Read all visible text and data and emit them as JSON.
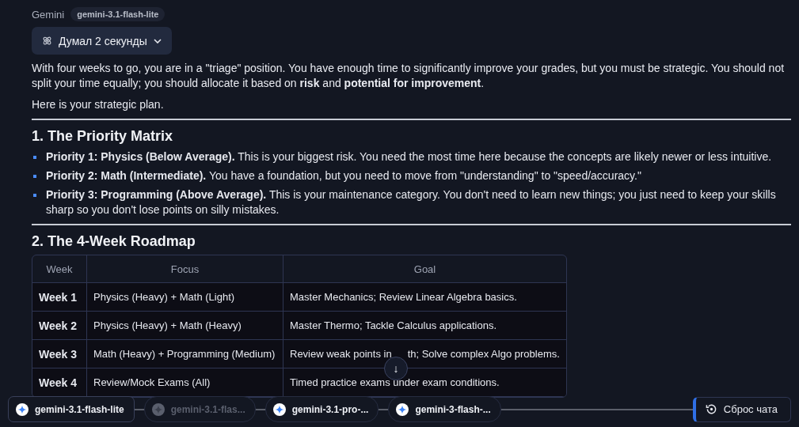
{
  "header": {
    "sender": "Gemini",
    "model_badge": "gemini-3.1-flash-lite"
  },
  "thinking": {
    "label": "Думал 2 секунды"
  },
  "intro": [
    "With four weeks to go, you are in a \"triage\" position. You have enough time to significantly improve your grades, but you must be strategic. You should not split your time equally; you should allocate it based on **risk** and **potential for improvement**.",
    "Here is your strategic plan."
  ],
  "sections": [
    {
      "heading": "1. The Priority Matrix",
      "bullets": [
        "**Priority 1: Physics (Below Average).** This is your biggest risk. You need the most time here because the concepts are likely newer or less intuitive.",
        "**Priority 2: Math (Intermediate).** You have a foundation, but you need to move from \"understanding\" to \"speed/accuracy.\"",
        "**Priority 3: Programming (Above Average).** This is your maintenance category. You don't need to learn new things; you just need to keep your skills sharp so you don't lose points on silly mistakes."
      ]
    },
    {
      "heading": "2. The 4-Week Roadmap",
      "table": {
        "columns": [
          "Week",
          "Focus",
          "Goal"
        ],
        "rows": [
          [
            "Week 1",
            "Physics (Heavy) + Math (Light)",
            "Master Mechanics; Review Linear Algebra basics."
          ],
          [
            "Week 2",
            "Physics (Heavy) + Math (Heavy)",
            "Master Thermo; Tackle Calculus applications."
          ],
          [
            "Week 3",
            "Math (Heavy) + Programming (Medium)",
            [
              "Review weak points in",
              "th; Solve complex Algo problems."
            ]
          ],
          [
            "Week 4",
            "Review/Mock Exams (All)",
            "Timed practice exams under exam conditions."
          ]
        ]
      }
    }
  ],
  "scroll_button": {
    "label": "↓"
  },
  "model_chips": [
    {
      "label": "gemini-3.1-flash-lite",
      "selected": true,
      "disabled": false
    },
    {
      "label": "gemini-3.1-flas...",
      "selected": false,
      "disabled": true
    },
    {
      "label": "gemini-3.1-pro-...",
      "selected": false,
      "disabled": false
    },
    {
      "label": "gemini-3-flash-...",
      "selected": false,
      "disabled": false
    }
  ],
  "reset_button": {
    "label": "Сброс чата"
  }
}
